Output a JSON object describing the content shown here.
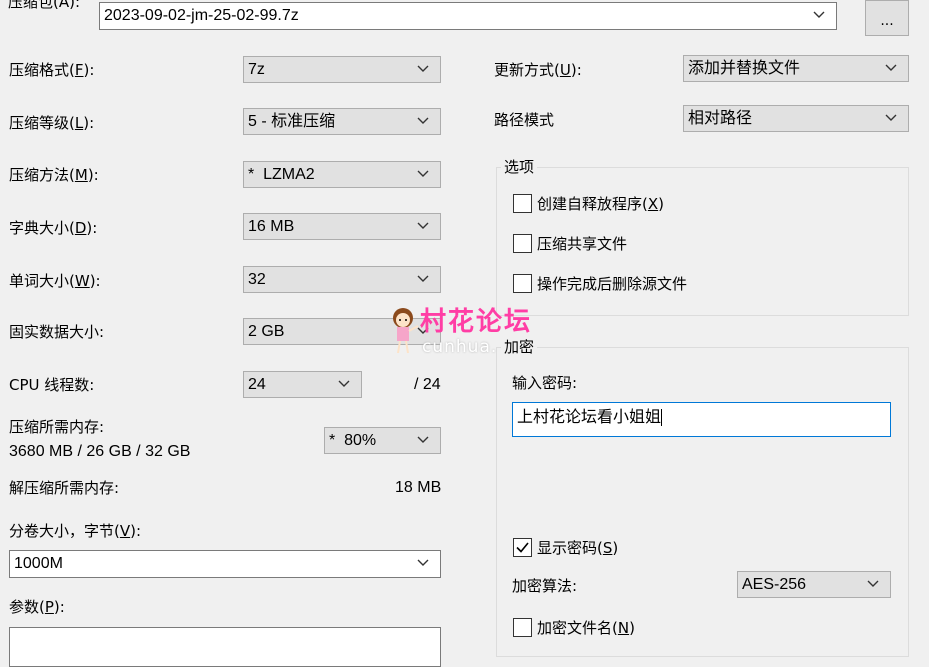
{
  "archive": {
    "label": "压缩包(A):",
    "path": "2023-09-02-jm-25-02-99.7z",
    "browse_label": "..."
  },
  "left": {
    "format": {
      "label_pre": "压缩格式(",
      "key": "F",
      "label_post": "):",
      "value": "7z"
    },
    "level": {
      "label_pre": "压缩等级(",
      "key": "L",
      "label_post": "):",
      "value": "5 - 标准压缩"
    },
    "method": {
      "label_pre": "压缩方法(",
      "key": "M",
      "label_post": "):",
      "value": "*  LZMA2"
    },
    "dict": {
      "label_pre": "字典大小(",
      "key": "D",
      "label_post": "):",
      "value": "16 MB"
    },
    "word": {
      "label_pre": "单词大小(",
      "key": "W",
      "label_post": "):",
      "value": "32"
    },
    "solid": {
      "label": "固实数据大小:",
      "value": "2 GB"
    },
    "threads": {
      "label": "CPU 线程数:",
      "value": "24",
      "max": "/ 24"
    },
    "mem_compress": {
      "label": "压缩所需内存:",
      "detail": "3680 MB / 26 GB / 32 GB",
      "value": "*  80%"
    },
    "mem_decompress": {
      "label": "解压缩所需内存:",
      "value": "18 MB"
    },
    "volume": {
      "label_pre": "分卷大小，字节(",
      "key": "V",
      "label_post": "):",
      "value": "1000M"
    },
    "params": {
      "label_pre": "参数(",
      "key": "P",
      "label_post": "):",
      "value": ""
    }
  },
  "right": {
    "update": {
      "label_pre": "更新方式(",
      "key": "U",
      "label_post": "):",
      "value": "添加并替换文件"
    },
    "path_mode": {
      "label": "路径模式",
      "value": "相对路径"
    },
    "options": {
      "title": "选项",
      "sfx": {
        "label_pre": "创建自释放程序(",
        "key": "X",
        "label_post": ")",
        "checked": false
      },
      "shared": {
        "label": "压缩共享文件",
        "checked": false
      },
      "delete": {
        "label": "操作完成后删除源文件",
        "checked": false
      }
    },
    "encryption": {
      "title": "加密",
      "password_label": "输入密码:",
      "password_value": "上村花论坛看小姐姐",
      "show_pw": {
        "label_pre": "显示密码(",
        "key": "S",
        "label_post": ")",
        "checked": true
      },
      "method_label": "加密算法:",
      "method_value": "AES-256",
      "encrypt_names": {
        "label_pre": "加密文件名(",
        "key": "N",
        "label_post": ")",
        "checked": false
      }
    }
  },
  "watermark": {
    "title": "村花论坛",
    "sub": "cunhua."
  }
}
